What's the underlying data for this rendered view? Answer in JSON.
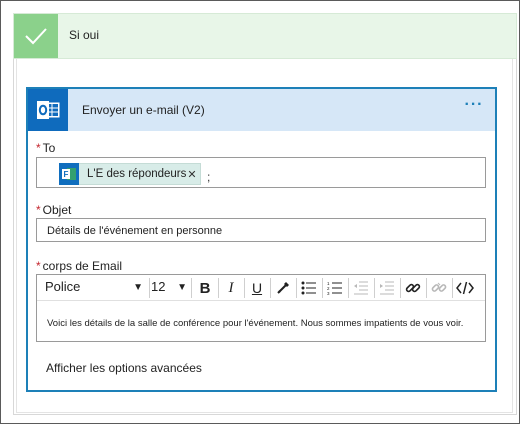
{
  "branch": {
    "title": "Si oui"
  },
  "action": {
    "title": "Envoyer un e-mail (V2)",
    "more_label": "···"
  },
  "to_field": {
    "label": "To",
    "required_mark": "*",
    "token_label": "L'E des répondeurs",
    "token_remove": "✕",
    "separator": ";"
  },
  "subject_field": {
    "label": "Objet",
    "required_mark": "*",
    "value": "Détails de l'événement en personne"
  },
  "body_field": {
    "label": "corps de Email",
    "required_mark": "*",
    "font_value": "Police",
    "size_value": "12",
    "value": "Voici les détails de la salle de conférence pour l'événement. Nous sommes impatients de vous voir."
  },
  "advanced_link": "Afficher les options avancées",
  "colors": {
    "success_header": "#e8f6e8",
    "check_tile": "#8bd18b",
    "card_border": "#1d80b8",
    "card_header": "#d6e7f7",
    "outlook_tile": "#0f6bbd",
    "required": "#c4262e"
  }
}
